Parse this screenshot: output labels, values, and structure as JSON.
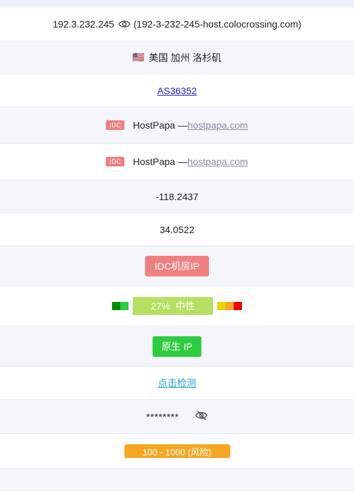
{
  "ip": {
    "address": "192.3.232.245",
    "hostname": "(192-3-232-245-host.colocrossing.com)"
  },
  "location": {
    "flag": "🇺🇸",
    "text": "美国 加州 洛杉矶"
  },
  "asn": "AS36352",
  "isp": {
    "tag": "IDC",
    "name": "HostPapa — ",
    "domain": "hostpapa.com"
  },
  "org": {
    "tag": "IDC",
    "name": "HostPapa — ",
    "domain": "hostpapa.com"
  },
  "longitude": "-118.2437",
  "latitude": "34.0522",
  "ip_type": "IDC机房IP",
  "score": {
    "percent_label": "27%",
    "level": "中性",
    "value_percent": 27
  },
  "native": "原生 IP",
  "detect": "点击检测",
  "masked": "********",
  "risk": "100 - 1000 (风险)",
  "colors": {
    "red_badge": "#f08080",
    "green_badge": "#2ecc40",
    "orange_badge": "#f5a623",
    "score_bar": "#b5e061"
  }
}
